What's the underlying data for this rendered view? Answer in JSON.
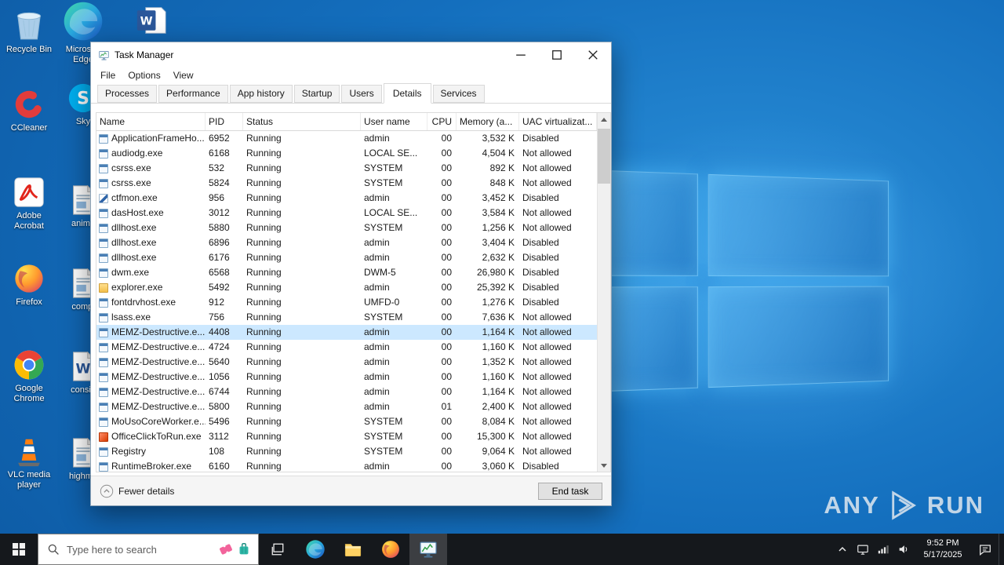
{
  "desktop": {
    "col1": [
      {
        "label": "Recycle Bin",
        "icon": "recycle-bin"
      },
      {
        "label": "CCleaner",
        "icon": "ccleaner"
      },
      {
        "label": "Adobe Acrobat",
        "icon": "acrobat"
      },
      {
        "label": "Firefox",
        "icon": "firefox"
      },
      {
        "label": "Google Chrome",
        "icon": "chrome"
      },
      {
        "label": "VLC media player",
        "icon": "vlc"
      }
    ],
    "col2": [
      {
        "label": "Microsoft Edge",
        "icon": "edge"
      },
      {
        "label": "Sky",
        "icon": "skype"
      },
      {
        "label": "anima",
        "icon": "doc"
      },
      {
        "label": "compl",
        "icon": "doc"
      },
      {
        "label": "consid",
        "icon": "worddoc"
      },
      {
        "label": "highma",
        "icon": "doc"
      }
    ],
    "top_icon": {
      "label": "",
      "icon": "word"
    }
  },
  "task_manager": {
    "title": "Task Manager",
    "menus": [
      "File",
      "Options",
      "View"
    ],
    "tabs": [
      "Processes",
      "Performance",
      "App history",
      "Startup",
      "Users",
      "Details",
      "Services"
    ],
    "active_tab": "Details",
    "columns": [
      {
        "key": "name",
        "label": "Name"
      },
      {
        "key": "pid",
        "label": "PID"
      },
      {
        "key": "status",
        "label": "Status"
      },
      {
        "key": "user",
        "label": "User name"
      },
      {
        "key": "cpu",
        "label": "CPU"
      },
      {
        "key": "memory",
        "label": "Memory (a..."
      },
      {
        "key": "uac",
        "label": "UAC virtualizat..."
      }
    ],
    "selected_row_index": 13,
    "rows": [
      {
        "icon": "app",
        "name": "ApplicationFrameHo...",
        "pid": "6952",
        "status": "Running",
        "user": "admin",
        "cpu": "00",
        "memory": "3,532 K",
        "uac": "Disabled"
      },
      {
        "icon": "app",
        "name": "audiodg.exe",
        "pid": "6168",
        "status": "Running",
        "user": "LOCAL SE...",
        "cpu": "00",
        "memory": "4,504 K",
        "uac": "Not allowed"
      },
      {
        "icon": "app",
        "name": "csrss.exe",
        "pid": "532",
        "status": "Running",
        "user": "SYSTEM",
        "cpu": "00",
        "memory": "892 K",
        "uac": "Not allowed"
      },
      {
        "icon": "app",
        "name": "csrss.exe",
        "pid": "5824",
        "status": "Running",
        "user": "SYSTEM",
        "cpu": "00",
        "memory": "848 K",
        "uac": "Not allowed"
      },
      {
        "icon": "pen",
        "name": "ctfmon.exe",
        "pid": "956",
        "status": "Running",
        "user": "admin",
        "cpu": "00",
        "memory": "3,452 K",
        "uac": "Disabled"
      },
      {
        "icon": "app",
        "name": "dasHost.exe",
        "pid": "3012",
        "status": "Running",
        "user": "LOCAL SE...",
        "cpu": "00",
        "memory": "3,584 K",
        "uac": "Not allowed"
      },
      {
        "icon": "app",
        "name": "dllhost.exe",
        "pid": "5880",
        "status": "Running",
        "user": "SYSTEM",
        "cpu": "00",
        "memory": "1,256 K",
        "uac": "Not allowed"
      },
      {
        "icon": "app",
        "name": "dllhost.exe",
        "pid": "6896",
        "status": "Running",
        "user": "admin",
        "cpu": "00",
        "memory": "3,404 K",
        "uac": "Disabled"
      },
      {
        "icon": "app",
        "name": "dllhost.exe",
        "pid": "6176",
        "status": "Running",
        "user": "admin",
        "cpu": "00",
        "memory": "2,632 K",
        "uac": "Disabled"
      },
      {
        "icon": "app",
        "name": "dwm.exe",
        "pid": "6568",
        "status": "Running",
        "user": "DWM-5",
        "cpu": "00",
        "memory": "26,980 K",
        "uac": "Disabled"
      },
      {
        "icon": "folder",
        "name": "explorer.exe",
        "pid": "5492",
        "status": "Running",
        "user": "admin",
        "cpu": "00",
        "memory": "25,392 K",
        "uac": "Disabled"
      },
      {
        "icon": "app",
        "name": "fontdrvhost.exe",
        "pid": "912",
        "status": "Running",
        "user": "UMFD-0",
        "cpu": "00",
        "memory": "1,276 K",
        "uac": "Disabled"
      },
      {
        "icon": "app",
        "name": "lsass.exe",
        "pid": "756",
        "status": "Running",
        "user": "SYSTEM",
        "cpu": "00",
        "memory": "7,636 K",
        "uac": "Not allowed"
      },
      {
        "icon": "app",
        "name": "MEMZ-Destructive.e...",
        "pid": "4408",
        "status": "Running",
        "user": "admin",
        "cpu": "00",
        "memory": "1,164 K",
        "uac": "Not allowed"
      },
      {
        "icon": "app",
        "name": "MEMZ-Destructive.e...",
        "pid": "4724",
        "status": "Running",
        "user": "admin",
        "cpu": "00",
        "memory": "1,160 K",
        "uac": "Not allowed"
      },
      {
        "icon": "app",
        "name": "MEMZ-Destructive.e...",
        "pid": "5640",
        "status": "Running",
        "user": "admin",
        "cpu": "00",
        "memory": "1,352 K",
        "uac": "Not allowed"
      },
      {
        "icon": "app",
        "name": "MEMZ-Destructive.e...",
        "pid": "1056",
        "status": "Running",
        "user": "admin",
        "cpu": "00",
        "memory": "1,160 K",
        "uac": "Not allowed"
      },
      {
        "icon": "app",
        "name": "MEMZ-Destructive.e...",
        "pid": "6744",
        "status": "Running",
        "user": "admin",
        "cpu": "00",
        "memory": "1,164 K",
        "uac": "Not allowed"
      },
      {
        "icon": "app",
        "name": "MEMZ-Destructive.e...",
        "pid": "5800",
        "status": "Running",
        "user": "admin",
        "cpu": "01",
        "memory": "2,400 K",
        "uac": "Not allowed"
      },
      {
        "icon": "app",
        "name": "MoUsoCoreWorker.e...",
        "pid": "5496",
        "status": "Running",
        "user": "SYSTEM",
        "cpu": "00",
        "memory": "8,084 K",
        "uac": "Not allowed"
      },
      {
        "icon": "office",
        "name": "OfficeClickToRun.exe",
        "pid": "3112",
        "status": "Running",
        "user": "SYSTEM",
        "cpu": "00",
        "memory": "15,300 K",
        "uac": "Not allowed"
      },
      {
        "icon": "app",
        "name": "Registry",
        "pid": "108",
        "status": "Running",
        "user": "SYSTEM",
        "cpu": "00",
        "memory": "9,064 K",
        "uac": "Not allowed"
      },
      {
        "icon": "app",
        "name": "RuntimeBroker.exe",
        "pid": "6160",
        "status": "Running",
        "user": "admin",
        "cpu": "00",
        "memory": "3,060 K",
        "uac": "Disabled"
      }
    ],
    "footer": {
      "details_toggle": "Fewer details",
      "end_task_label": "End task"
    }
  },
  "taskbar": {
    "search_placeholder": "Type here to search",
    "clock": {
      "time": "9:52 PM",
      "date": "5/17/2025"
    }
  },
  "watermark": {
    "left": "ANY",
    "right": "RUN"
  },
  "colors": {
    "accent": "#0078d7",
    "selection": "#cce8ff",
    "taskbar": "#15181c"
  }
}
